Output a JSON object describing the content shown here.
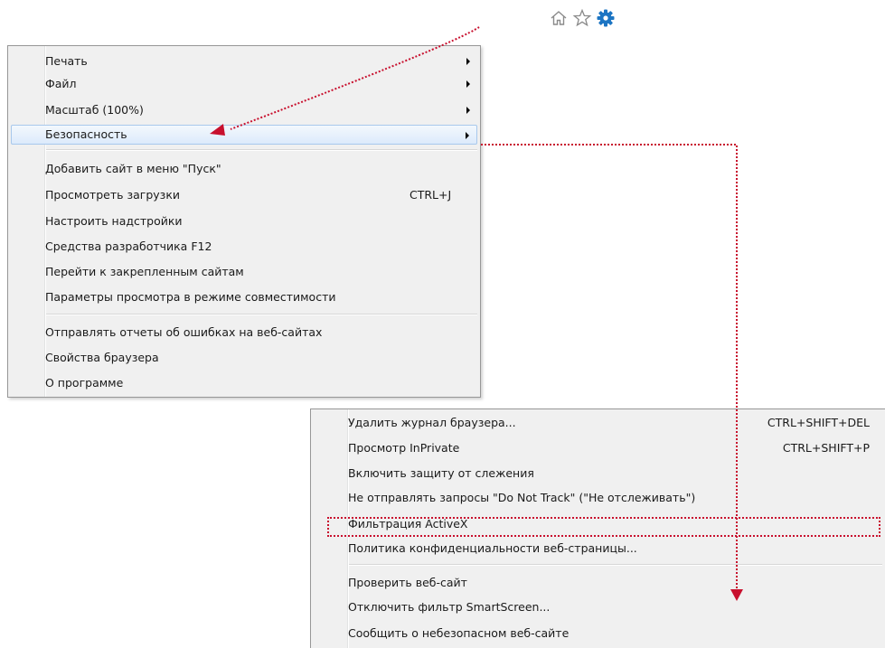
{
  "toolbar": {
    "icons": [
      {
        "name": "home-icon"
      },
      {
        "name": "favorites-star-icon"
      },
      {
        "name": "gear-icon",
        "color": "#1c75c3"
      }
    ]
  },
  "tools_menu": {
    "items": [
      {
        "label": "Печать",
        "submenu": true
      },
      {
        "label": "Файл",
        "submenu": true
      },
      {
        "label": "Масштаб (100%)",
        "submenu": true
      },
      {
        "label": "Безопасность",
        "submenu": true,
        "highlighted": true
      },
      {
        "label": "Добавить сайт в меню \"Пуск\""
      },
      {
        "label": "Просмотреть загрузки",
        "shortcut": "CTRL+J"
      },
      {
        "label": "Настроить надстройки"
      },
      {
        "label": "Средства разработчика F12"
      },
      {
        "label": "Перейти к закрепленным сайтам"
      },
      {
        "label": "Параметры просмотра в режиме совместимости"
      },
      {
        "label": "Отправлять отчеты об ошибках на веб-сайтах"
      },
      {
        "label": "Свойства браузера"
      },
      {
        "label": "О программе"
      }
    ]
  },
  "security_submenu": {
    "items": [
      {
        "label": "Удалить журнал браузера...",
        "shortcut": "CTRL+SHIFT+DEL"
      },
      {
        "label": "Просмотр InPrivate",
        "shortcut": "CTRL+SHIFT+P"
      },
      {
        "label": "Включить защиту от слежения"
      },
      {
        "label": "Не отправлять запросы \"Do Not Track\" (\"Не отслеживать\")"
      },
      {
        "label": "Фильтрация ActiveX",
        "annotated": true
      },
      {
        "label": "Политика конфиденциальности веб-страницы..."
      },
      {
        "label": "Проверить веб-сайт"
      },
      {
        "label": "Отключить фильтр SmartScreen..."
      },
      {
        "label": "Сообщить о небезопасном веб-сайте"
      }
    ]
  },
  "colors": {
    "annotation": "#c8102e",
    "highlight_border": "#a8c8ec"
  }
}
